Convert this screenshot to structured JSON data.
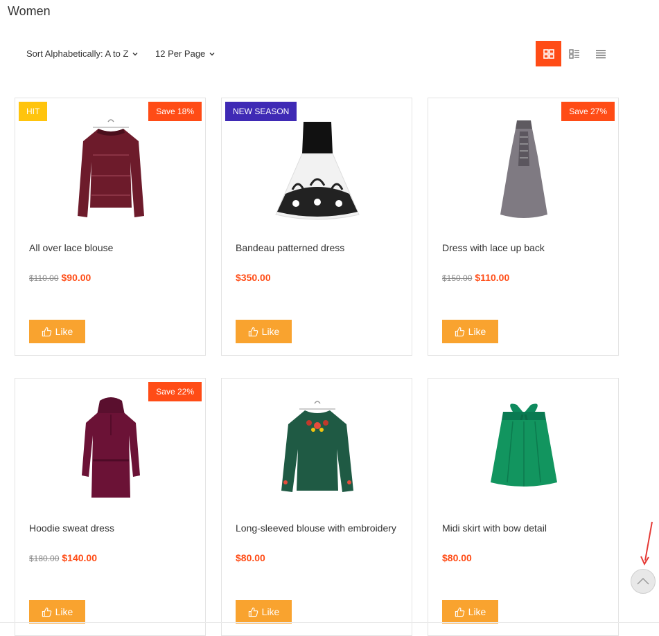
{
  "page": {
    "title": "Women"
  },
  "toolbar": {
    "sort_label": "Sort Alphabetically: A to Z",
    "per_page_label": "12 Per Page",
    "view_grid": "grid-view-icon",
    "view_grid_list": "grid-list-view-icon",
    "view_list": "list-view-icon"
  },
  "colors": {
    "accent": "#ff4c16",
    "like_button": "#f9a32f",
    "badge_hit": "#ffc40d",
    "badge_new": "#3f2ab5",
    "badge_save": "#ff4c16"
  },
  "products": [
    {
      "name": "All over lace blouse",
      "old_price": "$110.00",
      "price": "$90.00",
      "badge_left": "HIT",
      "badge_right": "Save 18%",
      "like": "Like",
      "image": "burgundy-lace-blouse"
    },
    {
      "name": "Bandeau patterned dress",
      "old_price": "",
      "price": "$350.00",
      "badge_left": "NEW SEASON",
      "badge_right": "",
      "like": "Like",
      "image": "black-white-patterned-dress"
    },
    {
      "name": "Dress with lace up back",
      "old_price": "$150.00",
      "price": "$110.00",
      "badge_left": "",
      "badge_right": "Save 27%",
      "like": "Like",
      "image": "grey-halter-dress"
    },
    {
      "name": "Hoodie sweat dress",
      "old_price": "$180.00",
      "price": "$140.00",
      "badge_left": "",
      "badge_right": "Save 22%",
      "like": "Like",
      "image": "burgundy-hoodie-dress"
    },
    {
      "name": "Long-sleeved blouse with embroidery",
      "old_price": "",
      "price": "$80.00",
      "badge_left": "",
      "badge_right": "",
      "like": "Like",
      "image": "green-embroidered-blouse"
    },
    {
      "name": "Midi skirt with bow detail",
      "old_price": "",
      "price": "$80.00",
      "badge_left": "",
      "badge_right": "",
      "like": "Like",
      "image": "green-midi-skirt"
    }
  ],
  "scroll_top": {
    "icon": "chevron-up-icon"
  }
}
